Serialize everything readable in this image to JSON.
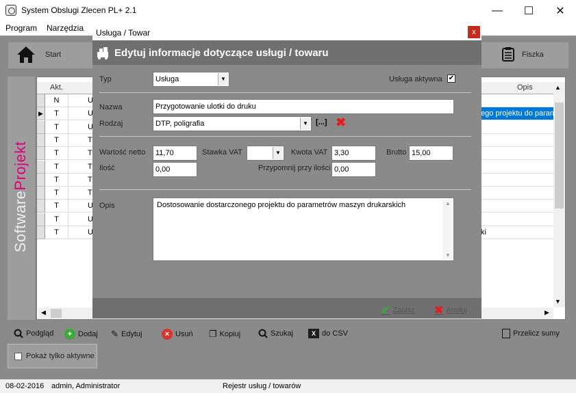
{
  "window": {
    "title": "System Obslugi Zlecen PL+ 2.1",
    "minimize": "—",
    "maximize": "☐",
    "close": "✕"
  },
  "menu": {
    "items": [
      "Program",
      "Narzędzia"
    ]
  },
  "toolbar": {
    "start_label": "Start",
    "fiszka_label": "Fiszka"
  },
  "logo": {
    "part1": "Software",
    "part2": "Projekt"
  },
  "grid": {
    "col_akt": "Akt.",
    "col_opis": "Opis",
    "rows": [
      {
        "akt": "N",
        "u": "U",
        "opis": ""
      },
      {
        "akt": "T",
        "u": "U",
        "opis": "ego projektu do paramet"
      },
      {
        "akt": "T",
        "u": "U",
        "opis": ""
      },
      {
        "akt": "T",
        "u": "T",
        "opis": ""
      },
      {
        "akt": "T",
        "u": "T",
        "opis": ""
      },
      {
        "akt": "T",
        "u": "T",
        "opis": ""
      },
      {
        "akt": "T",
        "u": "T",
        "opis": ""
      },
      {
        "akt": "T",
        "u": "T",
        "opis": ""
      },
      {
        "akt": "T",
        "u": "U",
        "opis": ""
      },
      {
        "akt": "T",
        "u": "U",
        "opis": ""
      },
      {
        "akt": "T",
        "u": "U",
        "opis": "ki"
      }
    ],
    "selected_row": 1
  },
  "bottom_toolbar": {
    "podglad": "Podgląd",
    "dodaj": "Dodaj",
    "edytuj": "Edytuj",
    "usun": "Usuń",
    "kopiuj": "Kopiuj",
    "szukaj": "Szukaj",
    "csv": "do CSV",
    "przelicz": "Przelicz sumy",
    "filter_label": "Pokaż tylko aktywne"
  },
  "status": {
    "date": "08-02-2016",
    "user": "admin, Administrator",
    "section": "Rejestr usług / towarów"
  },
  "dialog": {
    "window_title": "Usługa / Towar",
    "close": "x",
    "header_title": "Edytuj informacje dotyczące usługi / towaru",
    "typ_label": "Typ",
    "typ_value": "Usługa",
    "aktywna_label": "Usługa aktywna",
    "aktywna_checked": true,
    "nazwa_label": "Nazwa",
    "nazwa_value": "Przygotowanie ulotki do druku",
    "rodzaj_label": "Rodzaj",
    "rodzaj_value": "DTP, poligrafia",
    "rodzaj_browse": "[...]",
    "wartosc_label": "Wartość netto",
    "wartosc_value": "11,70",
    "stawka_label": "Stawka VAT",
    "stawka_value": "",
    "kwota_label": "Kwota VAT",
    "kwota_value": "3,30",
    "brutto_label": "Brutto",
    "brutto_value": "15,00",
    "ilosc_label": "Ilość",
    "ilosc_value": "0,00",
    "przypomnij_label": "Przypomnij przy ilości",
    "przypomnij_value": "0,00",
    "opis_label": "Opis",
    "opis_value": "Dostosowanie dostarczonego projektu do parametrów maszyn drukarskich",
    "zapisz": "Zapisz",
    "anuluj": "Anuluj"
  }
}
